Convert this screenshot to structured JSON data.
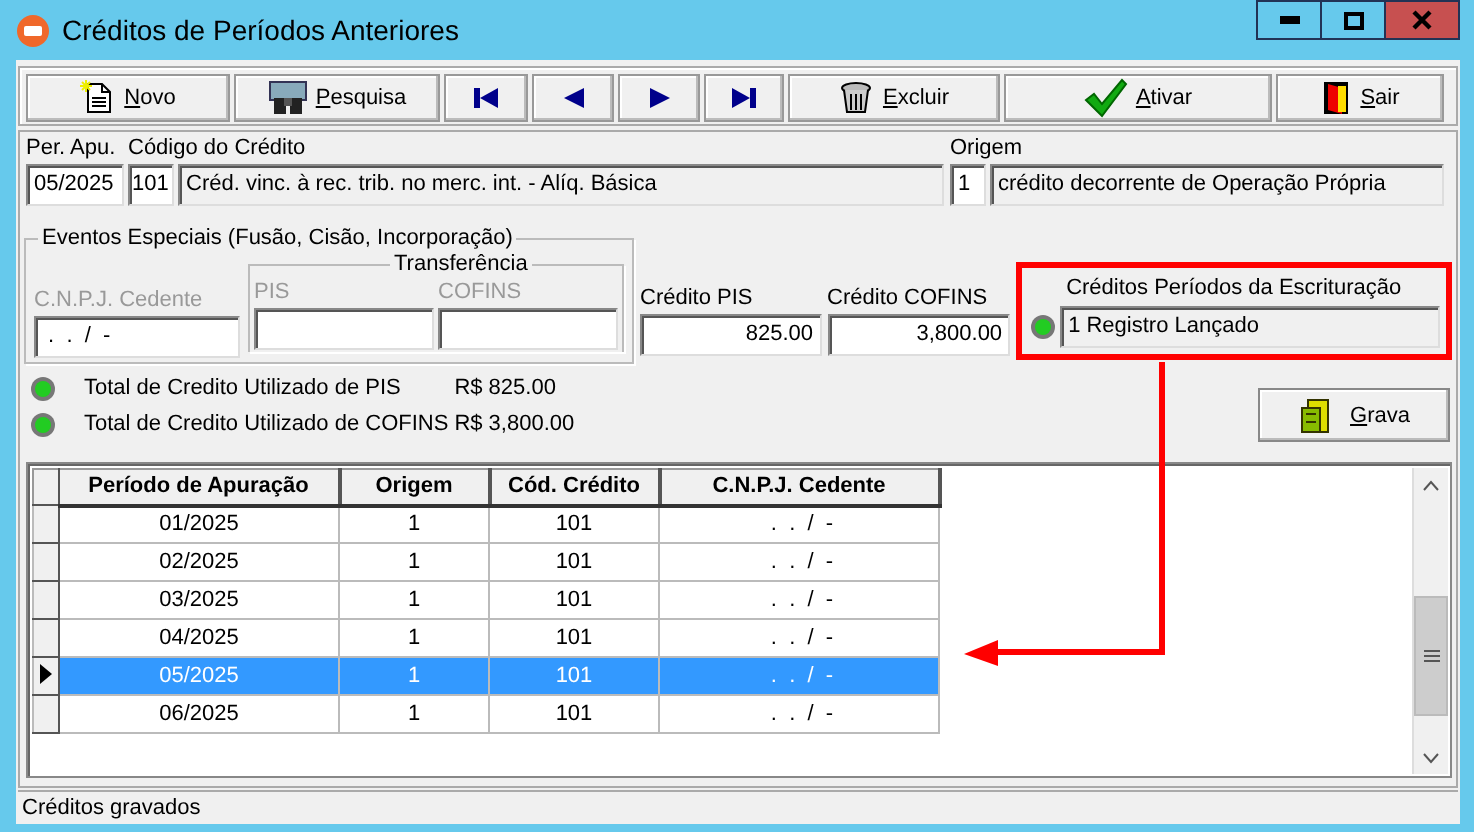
{
  "window": {
    "title": "Créditos de Períodos Anteriores"
  },
  "toolbar": [
    {
      "kind": "new",
      "label": "Novo"
    },
    {
      "kind": "search",
      "label": "Pesquisa"
    },
    {
      "kind": "first"
    },
    {
      "kind": "prev"
    },
    {
      "kind": "next"
    },
    {
      "kind": "last"
    },
    {
      "kind": "delete",
      "label": "Excluir"
    },
    {
      "kind": "activate",
      "label": "Ativar"
    },
    {
      "kind": "exit",
      "label": "Sair"
    }
  ],
  "form": {
    "period": {
      "label": "Per. Apu.",
      "value": "05/2025"
    },
    "credit": {
      "label": "Código do Crédito",
      "code": "101",
      "description": "Créd. vinc. à rec. trib. no merc. int. - Alíq. Básica"
    },
    "origin": {
      "label": "Origem",
      "code": "1",
      "description": "crédito decorrente de Operação Própria"
    }
  },
  "special_events": {
    "title": "Eventos Especiais (Fusão, Cisão, Incorporação)",
    "disabled": true,
    "cnpj": {
      "label": "C.N.P.J. Cedente",
      "value": " .  .  /  -"
    },
    "transfer": {
      "title": "Transferência",
      "pis": {
        "label": "PIS"
      },
      "cofins": {
        "label": "COFINS"
      }
    }
  },
  "credit_pis": {
    "label": "Crédito PIS",
    "value": "825.00"
  },
  "credit_cofins": {
    "label": "Crédito COFINS",
    "value": "3,800.00"
  },
  "bookkeeping": {
    "label": "Créditos Períodos da Escrituração",
    "value": "1 Registro Lançado",
    "color": "#22cc22"
  },
  "totals": [
    {
      "label": "Total de Credito Utilizado de PIS",
      "value": "R$ 825.00",
      "color": "#22cc22"
    },
    {
      "label": "Total de Credito Utilizado de COFINS",
      "value": "R$ 3,800.00",
      "color": "#22cc22"
    }
  ],
  "save_button": {
    "label": "Grava"
  },
  "table": {
    "columns": [
      "Período de Apuração",
      "Origem",
      "Cód. Crédito",
      "C.N.P.J. Cedente"
    ],
    "rows": [
      {
        "cells": [
          "01/2025",
          "1",
          "101",
          " .  .  /  -"
        ],
        "selected": false
      },
      {
        "cells": [
          "02/2025",
          "1",
          "101",
          " .  .  /  -"
        ],
        "selected": false
      },
      {
        "cells": [
          "03/2025",
          "1",
          "101",
          " .  .  /  -"
        ],
        "selected": false
      },
      {
        "cells": [
          "04/2025",
          "1",
          "101",
          " .  .  /  -"
        ],
        "selected": false
      },
      {
        "cells": [
          "05/2025",
          "1",
          "101",
          " .  .  /  -"
        ],
        "selected": true
      },
      {
        "cells": [
          "06/2025",
          "1",
          "101",
          " .  .  /  -"
        ],
        "selected": false
      }
    ]
  },
  "status_bar": {
    "text": "Créditos gravados"
  }
}
